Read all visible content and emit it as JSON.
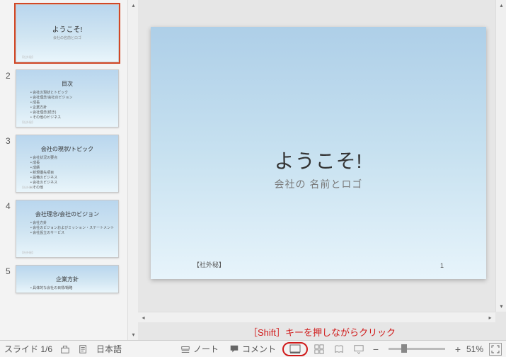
{
  "thumbnails": [
    {
      "num": "",
      "title": "ようこそ!",
      "sub": "会社の名前とロゴ",
      "bullets": [],
      "big": true
    },
    {
      "num": "2",
      "title": "目次",
      "sub": "",
      "bullets": [
        "会社の現状とトピック",
        "会社理念/会社のビジョン",
        "成長",
        "企業方針",
        "会社理念(続き)",
        "その他のビジネス"
      ],
      "big": false
    },
    {
      "num": "3",
      "title": "会社の現状/トピック",
      "sub": "",
      "bullets": [
        "会社状況の要点",
        "成長",
        "成績",
        "新規優先項目",
        "設備のビジネス",
        "会社のビジネス",
        "その他"
      ],
      "big": false
    },
    {
      "num": "4",
      "title": "会社理念/会社のビジョン",
      "sub": "",
      "bullets": [
        "会社方針",
        "会社のビジョンおよびミッション・ステートメント",
        "会社設立のサービス"
      ],
      "big": false
    },
    {
      "num": "5",
      "title": "企業方針",
      "sub": "",
      "bullets": [
        "具体的な会社の目標/戦略",
        ""
      ],
      "big": false
    }
  ],
  "main_slide": {
    "title": "ようこそ!",
    "subtitle": "会社の 名前とロゴ",
    "footer_left": "【社外秘】",
    "page_num": "1"
  },
  "annotation": "［Shift］キーを押しながらクリック",
  "status": {
    "slide_counter": "スライド 1/6",
    "language": "日本語",
    "notes": "ノート",
    "comments": "コメント",
    "zoom": "51%"
  }
}
